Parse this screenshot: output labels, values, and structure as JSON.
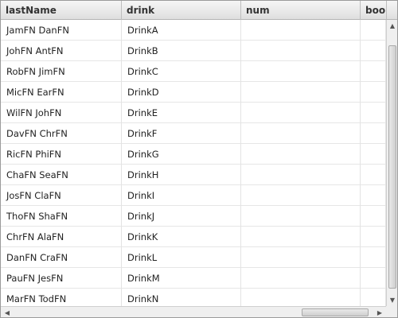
{
  "table": {
    "columns": [
      "lastName",
      "drink",
      "num",
      "bool"
    ],
    "rows": [
      {
        "lastName": "JamFN DanFN",
        "drink": "DrinkA",
        "num": "",
        "bool": ""
      },
      {
        "lastName": "JohFN AntFN",
        "drink": "DrinkB",
        "num": "",
        "bool": ""
      },
      {
        "lastName": "RobFN JimFN",
        "drink": "DrinkC",
        "num": "",
        "bool": ""
      },
      {
        "lastName": "MicFN EarFN",
        "drink": "DrinkD",
        "num": "",
        "bool": ""
      },
      {
        "lastName": "WilFN JohFN",
        "drink": "DrinkE",
        "num": "",
        "bool": ""
      },
      {
        "lastName": "DavFN ChrFN",
        "drink": "DrinkF",
        "num": "",
        "bool": ""
      },
      {
        "lastName": "RicFN PhiFN",
        "drink": "DrinkG",
        "num": "",
        "bool": ""
      },
      {
        "lastName": "ChaFN SeaFN",
        "drink": "DrinkH",
        "num": "",
        "bool": ""
      },
      {
        "lastName": "JosFN ClaFN",
        "drink": "DrinkI",
        "num": "",
        "bool": ""
      },
      {
        "lastName": "ThoFN ShaFN",
        "drink": "DrinkJ",
        "num": "",
        "bool": ""
      },
      {
        "lastName": "ChrFN AlaFN",
        "drink": "DrinkK",
        "num": "",
        "bool": ""
      },
      {
        "lastName": "DanFN CraFN",
        "drink": "DrinkL",
        "num": "",
        "bool": ""
      },
      {
        "lastName": "PauFN JesFN",
        "drink": "DrinkM",
        "num": "",
        "bool": ""
      },
      {
        "lastName": "MarFN TodFN",
        "drink": "DrinkN",
        "num": "",
        "bool": ""
      }
    ]
  },
  "icons": {
    "scroll_up": "▲",
    "scroll_down": "▼",
    "scroll_left": "◀",
    "scroll_right": "▶"
  }
}
